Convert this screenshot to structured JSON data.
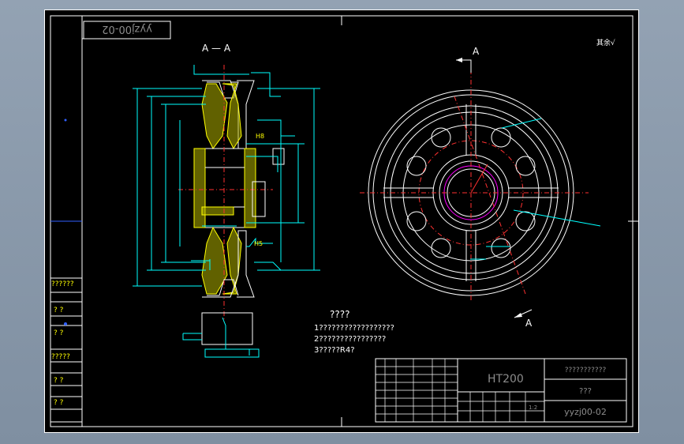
{
  "drawing": {
    "code_upside_down": "yyzj00-02",
    "section_title": "A — A",
    "view_label_top": "A",
    "view_label_bottom": "A",
    "roughness_mark": "其余√"
  },
  "tech": {
    "title": "????",
    "lines": [
      "1??????????????????",
      "2????????????????",
      "3?????R4?"
    ]
  },
  "side_table": {
    "cells": [
      "??????",
      "?   ?",
      "?   ?",
      "?????",
      "?   ?",
      "?   ?"
    ]
  },
  "title_block": {
    "material": "HT200",
    "name_line1": "???????????",
    "name_line2": "???",
    "drawing_no": "yyzj00-02",
    "scale": "1:2"
  },
  "dims": {
    "h8": "H8",
    "h5": "H5"
  },
  "colors": {
    "border": "#ffffff",
    "dimension": "#00ffff",
    "centerline": "#ff3030",
    "text": "#ffffff",
    "hatch": "#ffff00"
  }
}
